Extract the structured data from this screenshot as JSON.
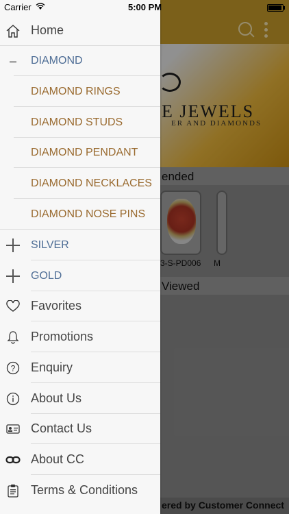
{
  "status_bar": {
    "carrier": "Carrier",
    "time": "5:00 PM"
  },
  "background": {
    "banner_logo": "E JEWELS",
    "banner_tagline": "ER AND DIAMONDS",
    "section_recommended": "ended",
    "product_captions": [
      "3-S-PD006",
      "M"
    ],
    "section_viewed": "Viewed",
    "footer_text": "ered by Customer Connect"
  },
  "drawer": {
    "items": [
      {
        "label": "Home",
        "icon": "home-icon",
        "type": "main"
      },
      {
        "label": "DIAMOND",
        "icon": "minus-icon",
        "type": "category"
      },
      {
        "label": "DIAMOND RINGS",
        "type": "sub"
      },
      {
        "label": "DIAMOND STUDS",
        "type": "sub"
      },
      {
        "label": "DIAMOND PENDANT",
        "type": "sub"
      },
      {
        "label": "DIAMOND NECKLACES",
        "type": "sub"
      },
      {
        "label": "DIAMOND NOSE PINS",
        "type": "sub"
      },
      {
        "label": "SILVER",
        "icon": "plus-icon",
        "type": "category"
      },
      {
        "label": "GOLD",
        "icon": "plus-icon",
        "type": "category"
      },
      {
        "label": "Favorites",
        "icon": "heart-icon",
        "type": "main"
      },
      {
        "label": "Promotions",
        "icon": "bell-icon",
        "type": "main"
      },
      {
        "label": "Enquiry",
        "icon": "question-icon",
        "type": "main"
      },
      {
        "label": "About Us",
        "icon": "info-icon",
        "type": "main"
      },
      {
        "label": "Contact Us",
        "icon": "contact-card-icon",
        "type": "main"
      },
      {
        "label": "About CC",
        "icon": "link-icon",
        "type": "main"
      },
      {
        "label": "Terms & Conditions",
        "icon": "clipboard-icon",
        "type": "main"
      }
    ]
  },
  "colors": {
    "category": "#4f6e96",
    "subcategory": "#9a6b30",
    "topbar": "#c79b2a"
  }
}
